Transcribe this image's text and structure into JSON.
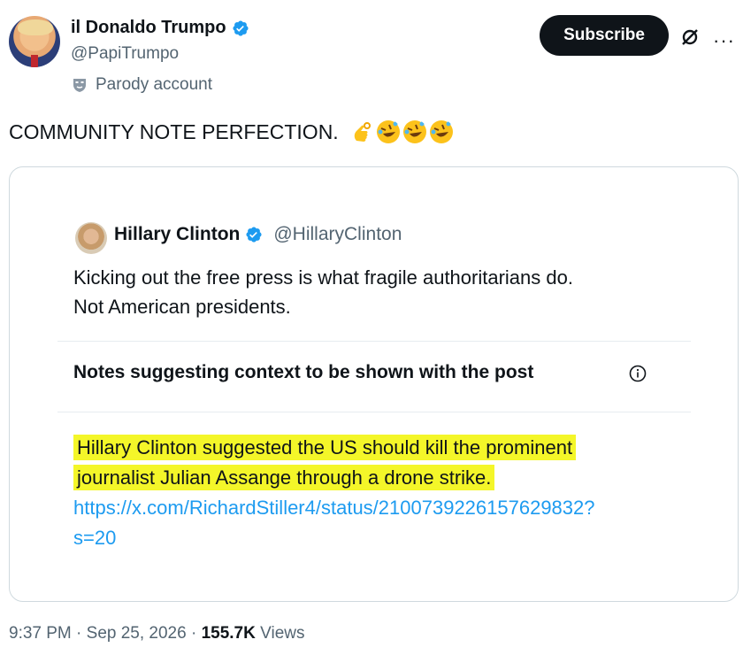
{
  "author": {
    "name": "il Donaldo Trumpo",
    "handle": "@PapiTrumpo",
    "label": "Parody account",
    "verified_color": "#1d9bf0"
  },
  "actions": {
    "subscribe_label": "Subscribe",
    "grok_icon": "grok-icon",
    "more_label": "···"
  },
  "post": {
    "text": "COMMUNITY NOTE PERFECTION.",
    "emojis": [
      "ok-hand",
      "rolling-laughing",
      "rolling-laughing",
      "rolling-laughing"
    ]
  },
  "quoted": {
    "name": "Hillary Clinton",
    "handle": "@HillaryClinton",
    "text_line1": "Kicking out the free press is what fragile authoritarians do.",
    "text_line2": "Not American presidents."
  },
  "note": {
    "title": "Notes suggesting context to be shown with the post",
    "line1": "Hillary Clinton suggested the US should kill the prominent",
    "line2": "journalist Julian Assange through a drone strike.",
    "link1": "https://x.com/RichardStiller4/status/2100739226157629832?",
    "link2": "s=20",
    "highlight_color": "#f4f629"
  },
  "footer": {
    "time": "9:37 PM · Sep 25, 2026 · ",
    "views_count": "155.7K",
    "views_label": " Views"
  }
}
